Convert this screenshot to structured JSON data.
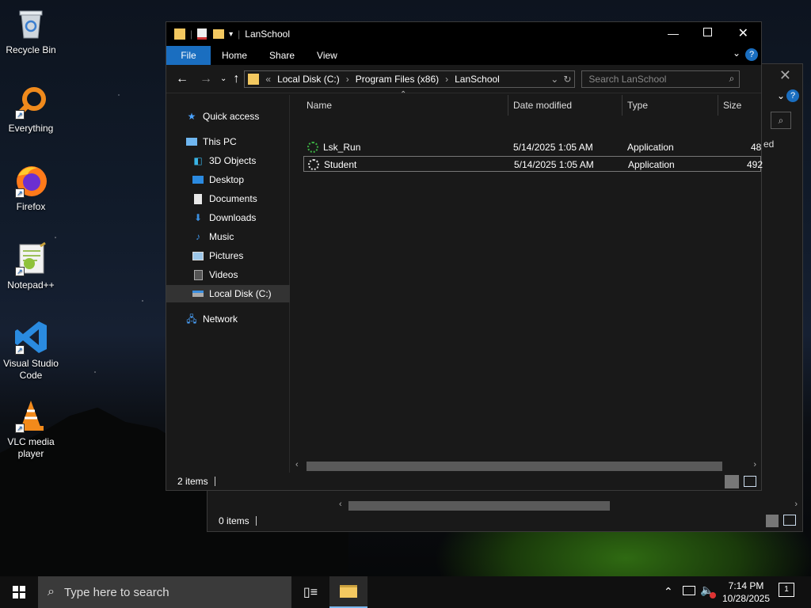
{
  "desktop": {
    "icons": [
      {
        "label": "Recycle Bin",
        "icon": "recycle-bin-icon"
      },
      {
        "label": "Everything",
        "icon": "everything-search-icon"
      },
      {
        "label": "Firefox",
        "icon": "firefox-icon"
      },
      {
        "label": "Notepad++",
        "icon": "notepad-plus-plus-icon"
      },
      {
        "label": "Visual Studio Code",
        "icon": "vscode-icon"
      },
      {
        "label": "VLC media player",
        "icon": "vlc-icon"
      }
    ]
  },
  "back_window": {
    "partial_text": "ed",
    "status": "0 items"
  },
  "explorer": {
    "title": "LanSchool",
    "ribbon_tabs": [
      "File",
      "Home",
      "Share",
      "View"
    ],
    "breadcrumb": [
      "Local Disk (C:)",
      "Program Files (x86)",
      "LanSchool"
    ],
    "breadcrumb_prefix": "«",
    "search_placeholder": "Search LanSchool",
    "nav": {
      "quick_access": "Quick access",
      "this_pc": "This PC",
      "items": [
        "3D Objects",
        "Desktop",
        "Documents",
        "Downloads",
        "Music",
        "Pictures",
        "Videos",
        "Local Disk (C:)"
      ],
      "network": "Network"
    },
    "columns": [
      "Name",
      "Date modified",
      "Type",
      "Size"
    ],
    "files": [
      {
        "name": "Lsk_Run",
        "date": "5/14/2025 1:05 AM",
        "type": "Application",
        "size": "48"
      },
      {
        "name": "Student",
        "date": "5/14/2025 1:05 AM",
        "type": "Application",
        "size": "492"
      }
    ],
    "status": "2 items"
  },
  "taskbar": {
    "search_placeholder": "Type here to search",
    "time": "7:14 PM",
    "date": "10/28/2025",
    "notification_count": "1"
  },
  "colors": {
    "accent": "#1a6ec0",
    "window_bg": "#191919",
    "taskbar_bg": "#101010",
    "selection": "#333333"
  }
}
